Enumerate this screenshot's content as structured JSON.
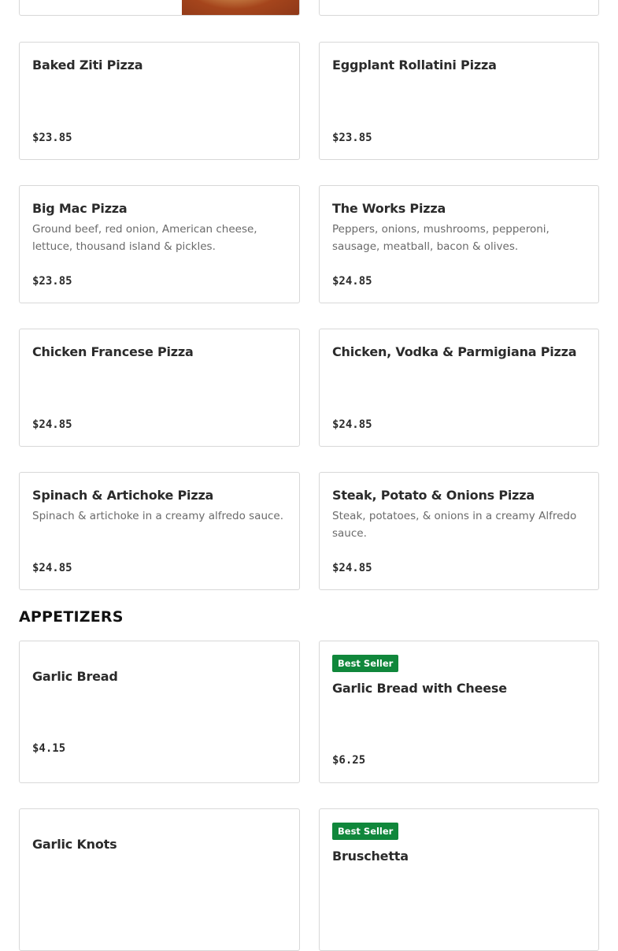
{
  "sections": {
    "appetizers_title": "APPETIZERS"
  },
  "pizzas": [
    {
      "name": "Baked Ziti Pizza",
      "description": "",
      "price": "$23.85"
    },
    {
      "name": "Eggplant Rollatini Pizza",
      "description": "",
      "price": "$23.85"
    },
    {
      "name": "Big Mac Pizza",
      "description": "Ground beef, red onion, American cheese, lettuce, thousand island & pickles.",
      "price": "$23.85"
    },
    {
      "name": "The Works Pizza",
      "description": "Peppers, onions, mushrooms, pepperoni, sausage, meatball, bacon & olives.",
      "price": "$24.85"
    },
    {
      "name": "Chicken Francese Pizza",
      "description": "",
      "price": "$24.85"
    },
    {
      "name": "Chicken, Vodka & Parmigiana Pizza",
      "description": "",
      "price": "$24.85"
    },
    {
      "name": "Spinach & Artichoke Pizza",
      "description": "Spinach & artichoke in a creamy alfredo sauce.",
      "price": "$24.85"
    },
    {
      "name": "Steak, Potato & Onions Pizza",
      "description": "Steak, potatoes, & onions in a creamy Alfredo sauce.",
      "price": "$24.85"
    }
  ],
  "appetizers": [
    {
      "name": "Garlic Bread",
      "badge": "",
      "price": "$4.15"
    },
    {
      "name": "Garlic Bread with Cheese",
      "badge": "Best Seller",
      "price": "$6.25"
    },
    {
      "name": "Garlic Knots",
      "badge": ""
    },
    {
      "name": "Bruschetta",
      "badge": "Best Seller"
    }
  ],
  "colors": {
    "badge_green": "#10873b",
    "card_border": "#d8d8d8",
    "description_gray": "#6a6a6a"
  }
}
